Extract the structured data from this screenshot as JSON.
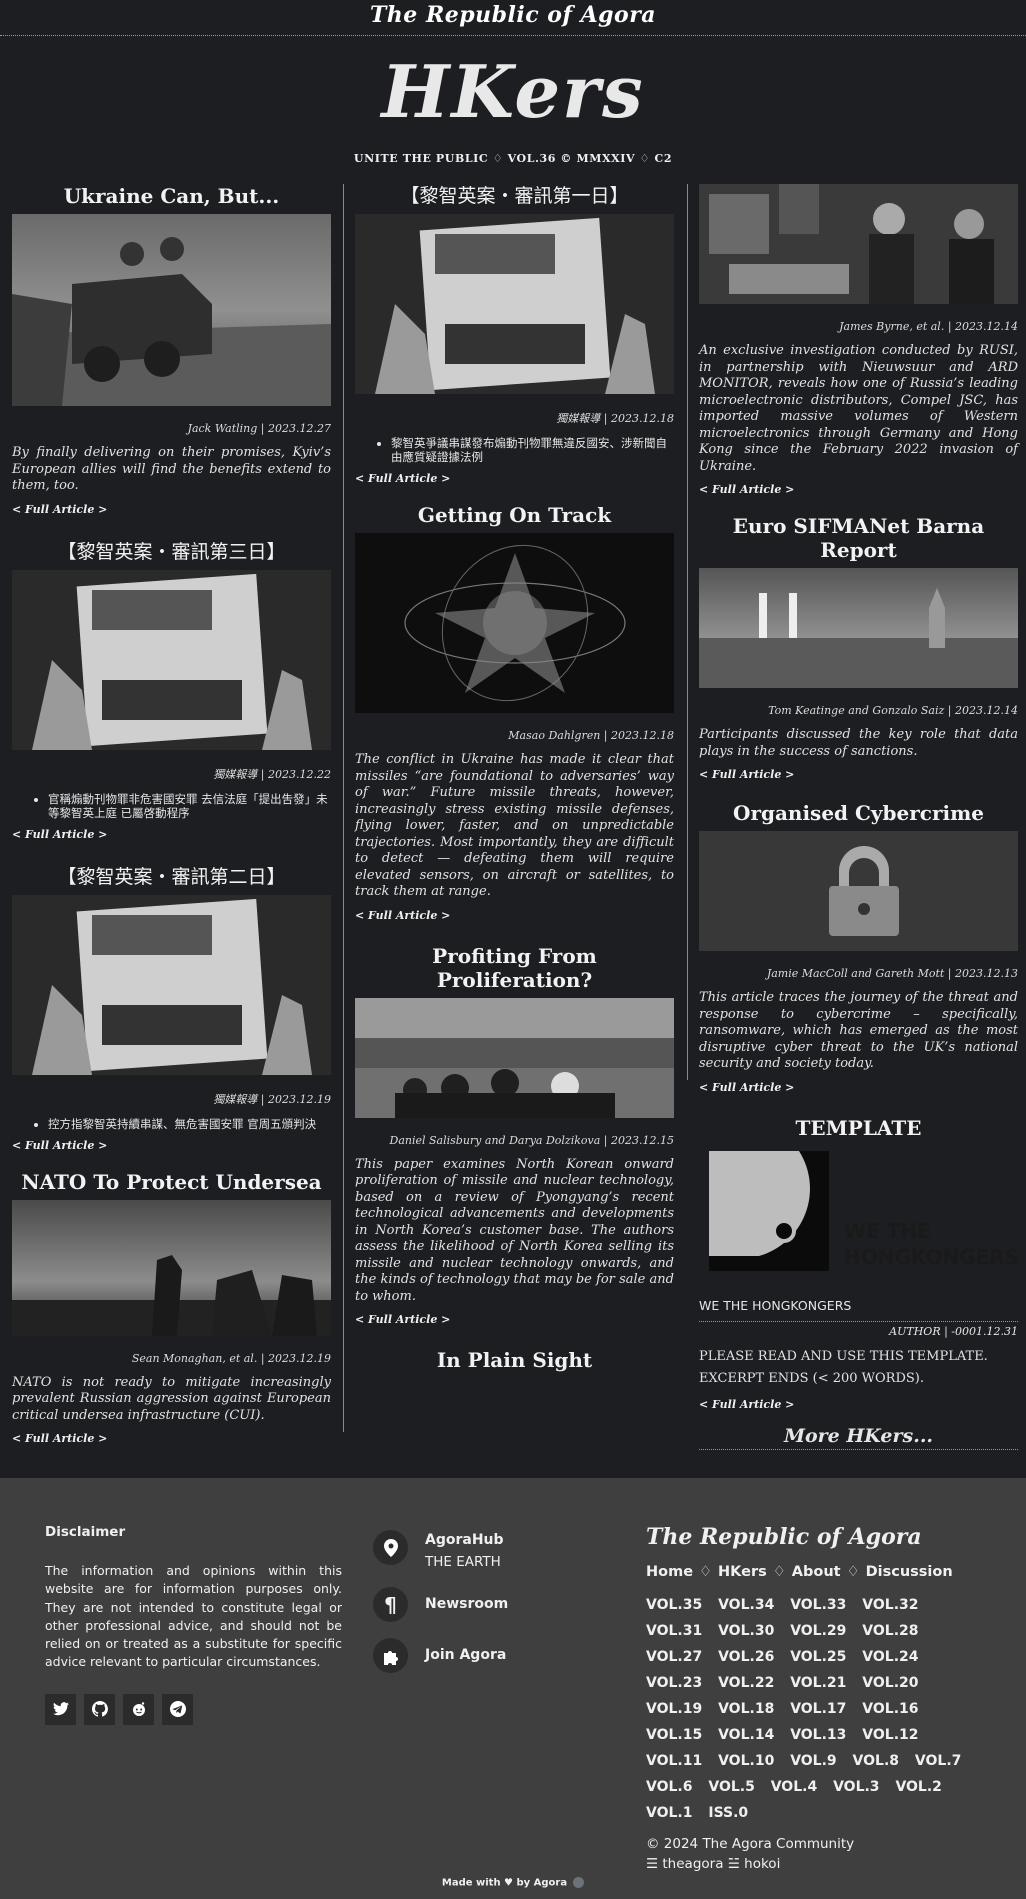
{
  "site": {
    "top_title": "The Republic of Agora",
    "masthead": "HKers",
    "tagline": "UNITE THE PUBLIC ♢ VOL.36 © MMXXIV ♢ C2"
  },
  "col1": [
    {
      "title": "Ukraine Can, But...",
      "byline": "Jack Watling | 2023.12.27",
      "excerpt": "By finally delivering on their promises, Kyiv’s European allies will find the benefits extend to them, too.",
      "more": "< Full Article >"
    },
    {
      "title": "【黎智英案・審訊第三日】",
      "byline": "獨媒報導 | 2023.12.22",
      "bullet": "官稱煽動刊物罪非危害國安罪 去信法庭「提出吿發」未等黎智英上庭 已屬啓動程序",
      "more": "< Full Article >"
    },
    {
      "title": "【黎智英案・審訊第二日】",
      "byline": "獨媒報導 | 2023.12.19",
      "bullet": "控方指黎智英持續串謀、無危害國安罪 官周五頒判決",
      "more": "< Full Article >"
    },
    {
      "title": "NATO To Protect Undersea",
      "byline": "Sean Monaghan, et al. | 2023.12.19",
      "excerpt": "NATO is not ready to mitigate increasingly prevalent Russian aggression against European critical undersea infrastructure (CUI).",
      "more": "< Full Article >"
    }
  ],
  "col2": [
    {
      "title": "【黎智英案・審訊第一日】",
      "byline": "獨媒報導 | 2023.12.18",
      "bullet": "黎智英爭議串謀發布煽動刊物罪無違反國安、涉新聞自由應質疑證據法例",
      "more": "< Full Article >"
    },
    {
      "title": "Getting On Track",
      "byline": "Masao Dahlgren | 2023.12.18",
      "excerpt": "The conflict in Ukraine has made it clear that missiles “are foundational to adversaries’ way of war.” Future missile threats, however, increasingly stress existing missile defenses, flying lower, faster, and on unpredictable trajectories. Most importantly, they are difficult to detect — defeating them will require elevated sensors, on aircraft or satellites, to track them at range.",
      "more": "< Full Article >"
    },
    {
      "title": "Profiting From Proliferation?",
      "byline": "Daniel Salisbury and Darya Dolzikova | 2023.12.15",
      "excerpt": "This paper examines North Korean onward proliferation of missile and nuclear technology, based on a review of Pyongyang’s recent technological advancements and developments in North Korea’s customer base. The authors assess the likelihood of North Korea selling its missile and nuclear technology onwards, and the kinds of technology that may be for sale and to whom.",
      "more": "< Full Article >"
    },
    {
      "title": "In Plain Sight"
    }
  ],
  "col3": [
    {
      "byline": "James Byrne, et al. | 2023.12.14",
      "excerpt": "An exclusive investigation conducted by RUSI, in partnership with Nieuwsuur and ARD MONITOR, reveals how one of Russia’s leading microelectronic distributors, Compel JSC, has imported massive volumes of Western microelectronics through Germany and Hong Kong since the February 2022 invasion of Ukraine.",
      "more": "< Full Article >"
    },
    {
      "title": "Euro SIFMANet Barna Report",
      "byline": "Tom Keatinge and Gonzalo Saiz | 2023.12.14",
      "excerpt": "Participants discussed the key role that data plays in the success of sanctions.",
      "more": "< Full Article >"
    },
    {
      "title": "Organised Cybercrime",
      "byline": "Jamie MacColl and Gareth Mott | 2023.12.13",
      "excerpt": "This article traces the journey of the threat and response to cybercrime – specifically, ransomware, which has emerged as the most disruptive cyber threat to the UK’s national security and society today.",
      "more": "< Full Article >"
    },
    {
      "title": "TEMPLATE",
      "logo_text": "WE THE HONGKONGERS",
      "plain": "WE THE HONGKONGERS",
      "byline": "AUTHOR | -0001.12.31",
      "text1": "PLEASE READ AND USE THIS TEMPLATE.",
      "text2": "EXCERPT ENDS (< 200 WORDS).",
      "more": "< Full Article >"
    }
  ],
  "more_hkers": "More HKers...",
  "footer": {
    "disclaimer_title": "Disclaimer",
    "disclaimer_text": "The information and opinions within this website are for information purposes only. They are not intended to constitute legal or other professional advice, and should not be relied on or treated as a substitute for specific advice relevant to particular circumstances.",
    "socials": [
      "twitter-icon",
      "github-icon",
      "reddit-icon",
      "telegram-icon"
    ],
    "hub_title": "AgoraHub",
    "hub_sub": "THE EARTH",
    "newsroom": "Newsroom",
    "join": "Join Agora",
    "brand": "The Republic of Agora",
    "nav": [
      "Home",
      "HKers",
      "About",
      "Discussion"
    ],
    "nav_sep": "♢",
    "vols": [
      "VOL.35",
      "VOL.34",
      "VOL.33",
      "VOL.32",
      "VOL.31",
      "VOL.30",
      "VOL.29",
      "VOL.28",
      "VOL.27",
      "VOL.26",
      "VOL.25",
      "VOL.24",
      "VOL.23",
      "VOL.22",
      "VOL.21",
      "VOL.20",
      "VOL.19",
      "VOL.18",
      "VOL.17",
      "VOL.16",
      "VOL.15",
      "VOL.14",
      "VOL.13",
      "VOL.12",
      "VOL.11",
      "VOL.10",
      "VOL.9",
      "VOL.8",
      "VOL.7",
      "VOL.6",
      "VOL.5",
      "VOL.4",
      "VOL.3",
      "VOL.2",
      "VOL.1",
      "ISS.0"
    ],
    "copyright": "© 2024 The Agora Community",
    "handles": "☰ theagora ☱ hokoi",
    "made_with": "Made with ♥ by Agora"
  }
}
